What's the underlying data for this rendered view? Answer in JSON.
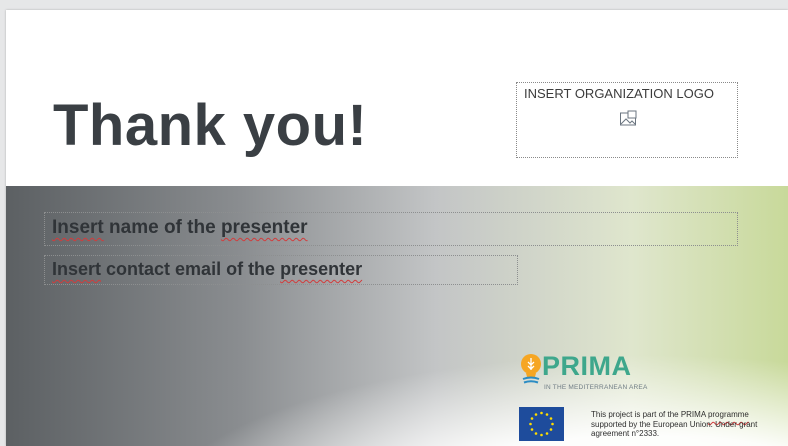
{
  "slide": {
    "title": "Thank you!",
    "logo_placeholder": "INSERT ORGANIZATION LOGO",
    "presenter_name": {
      "first": "Insert",
      "middle": " name of the ",
      "last": "presenter"
    },
    "presenter_email": {
      "first": "Insert",
      "middle": " contact email of the ",
      "last": "presenter"
    },
    "prima": {
      "name": "PRIMA",
      "tagline": "IN THE MEDITERRANEAN AREA"
    },
    "footer": {
      "part1": "This project is part of the PRIMA ",
      "link": "programme",
      "part2": " supported by the European Union. Under grant agreement n°2333."
    }
  },
  "colors": {
    "title": "#3a3f44",
    "prima_green": "#3ea78c",
    "prima_orange": "#f6a623",
    "eu_blue": "#1e4c9c",
    "eu_star": "#ffdd00",
    "spell_error": "#d23b3b"
  },
  "icons": {
    "logo_placeholder": "picture-placeholder-icon",
    "prima_logo": "lightbulb-icon",
    "eu_flag": "eu-flag-icon"
  }
}
